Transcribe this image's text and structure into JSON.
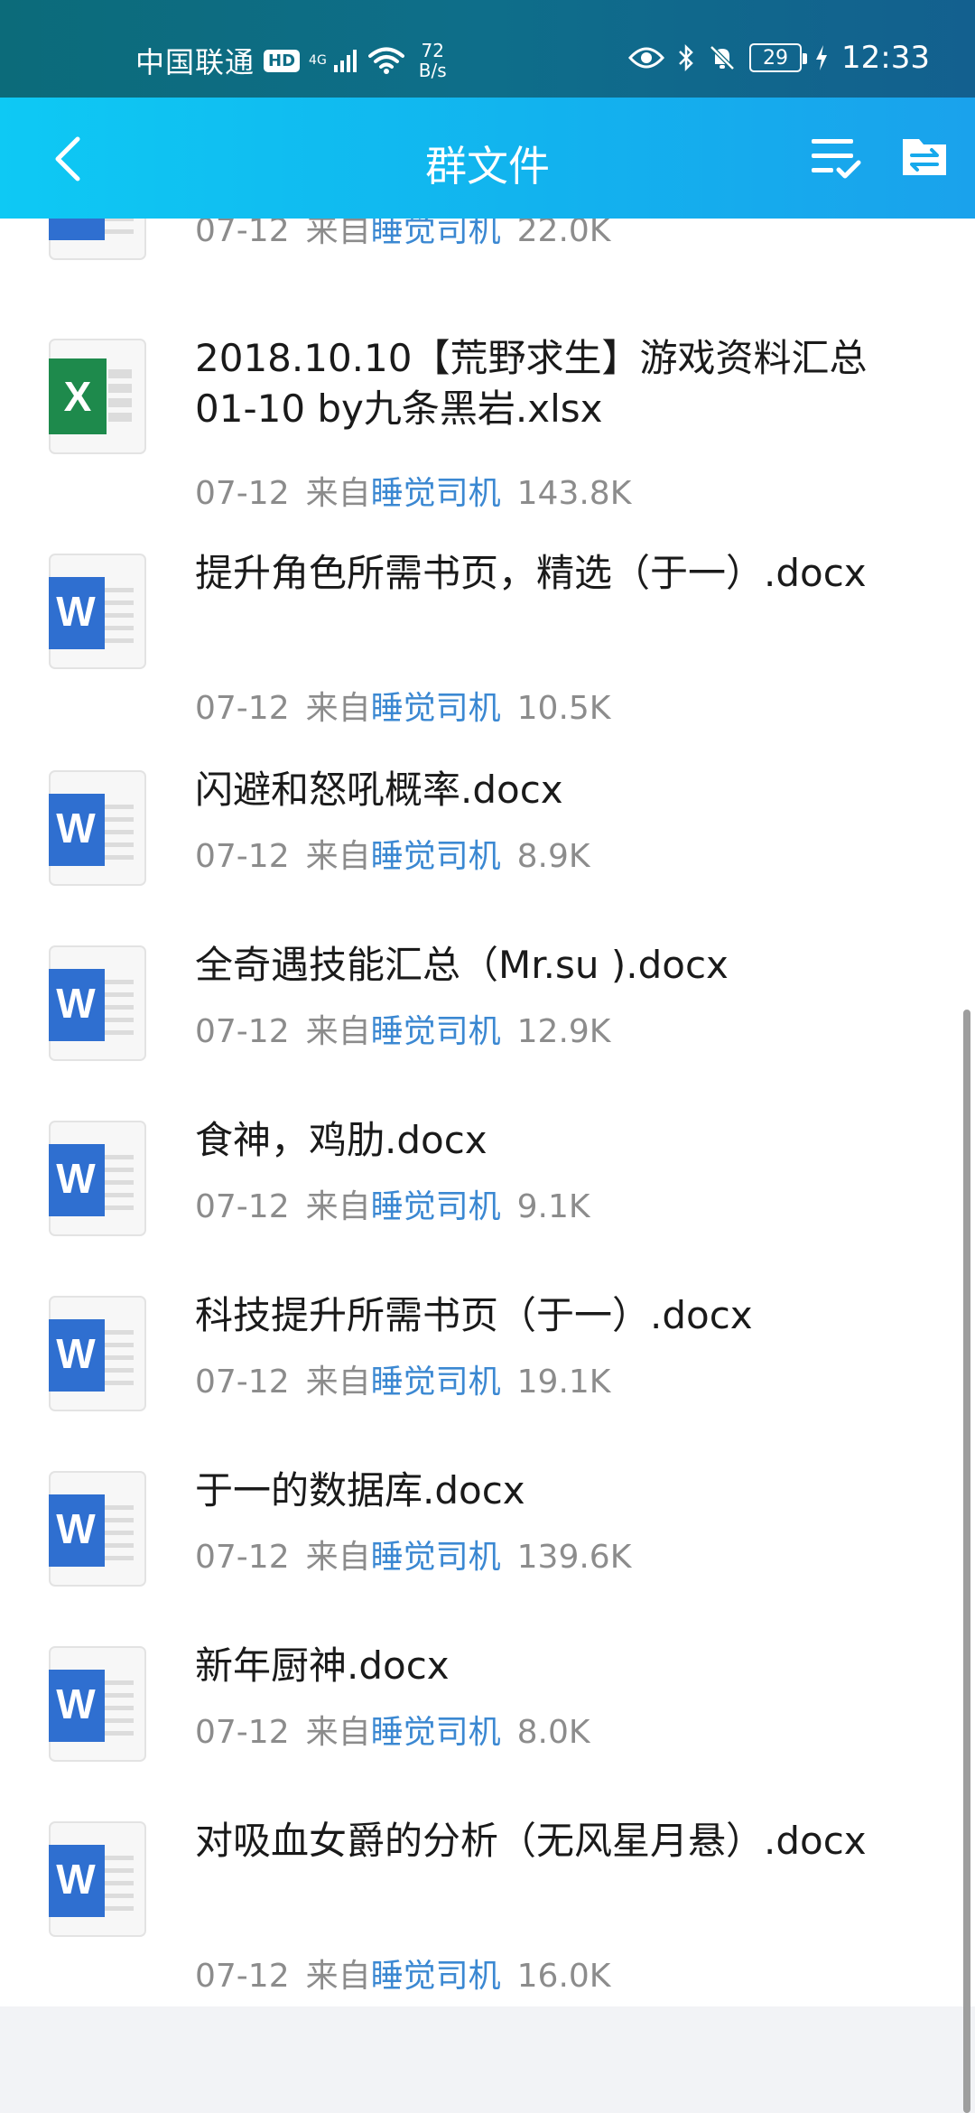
{
  "status_bar": {
    "carrier": "中国联通",
    "hd": "HD",
    "net_type": "4G",
    "speed_value": "72",
    "speed_unit": "B/s",
    "battery": "29",
    "time": "12:33"
  },
  "header": {
    "title": "群文件",
    "back_icon": "chevron-left-icon",
    "select_icon": "checklist-icon",
    "folder_icon": "folder-transfer-icon"
  },
  "files": [
    {
      "type": "word",
      "name": "",
      "date": "07-12",
      "from_label": "来自",
      "uploader": "睡觉司机",
      "size": "22.0K"
    },
    {
      "type": "excel",
      "name": "2018.10.10【荒野求生】游戏资料汇总 01-10 by九条黑岩.xlsx",
      "date": "07-12",
      "from_label": "来自",
      "uploader": "睡觉司机",
      "size": "143.8K"
    },
    {
      "type": "word",
      "name": "提升角色所需书页，精选（于一）.docx",
      "date": "07-12",
      "from_label": "来自",
      "uploader": "睡觉司机",
      "size": "10.5K"
    },
    {
      "type": "word",
      "name": "闪避和怒吼概率.docx",
      "date": "07-12",
      "from_label": "来自",
      "uploader": "睡觉司机",
      "size": "8.9K"
    },
    {
      "type": "word",
      "name": "全奇遇技能汇总（Mr.su ).docx",
      "date": "07-12",
      "from_label": "来自",
      "uploader": "睡觉司机",
      "size": "12.9K"
    },
    {
      "type": "word",
      "name": "食神，鸡肋.docx",
      "date": "07-12",
      "from_label": "来自",
      "uploader": "睡觉司机",
      "size": "9.1K"
    },
    {
      "type": "word",
      "name": "科技提升所需书页（于一）.docx",
      "date": "07-12",
      "from_label": "来自",
      "uploader": "睡觉司机",
      "size": "19.1K"
    },
    {
      "type": "word",
      "name": "于一的数据库.docx",
      "date": "07-12",
      "from_label": "来自",
      "uploader": "睡觉司机",
      "size": "139.6K"
    },
    {
      "type": "word",
      "name": "新年厨神.docx",
      "date": "07-12",
      "from_label": "来自",
      "uploader": "睡觉司机",
      "size": "8.0K"
    },
    {
      "type": "word",
      "name": "对吸血女爵的分析（无风星月悬）.docx",
      "date": "07-12",
      "from_label": "来自",
      "uploader": "睡觉司机",
      "size": "16.0K"
    }
  ],
  "colors": {
    "accent": "#12b3ee",
    "uploader": "#3b88d2",
    "word": "#2f6fd0",
    "excel": "#1e8a4c"
  }
}
